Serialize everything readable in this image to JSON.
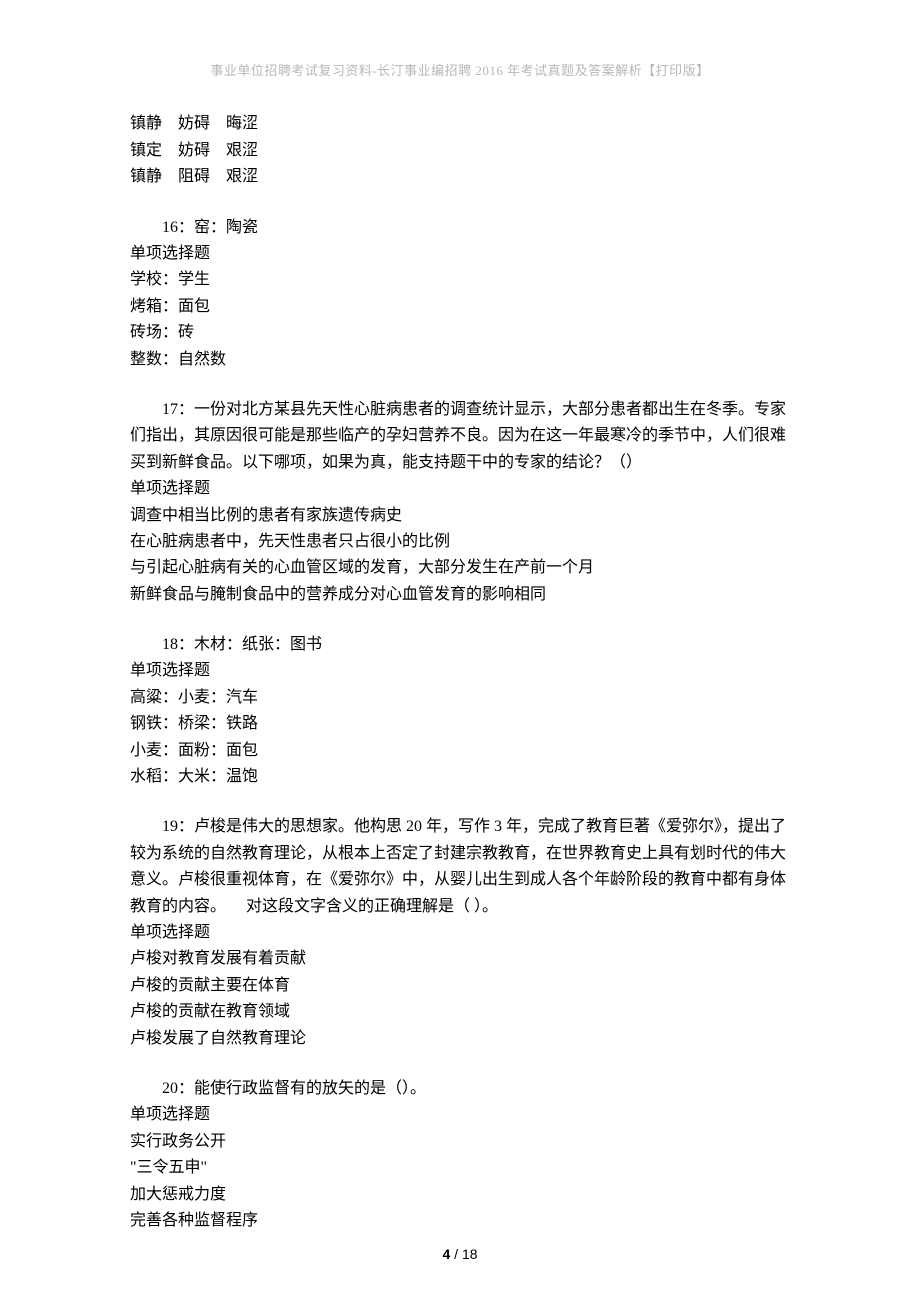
{
  "header": "事业单位招聘考试复习资料-长汀事业编招聘 2016 年考试真题及答案解析【打印版】",
  "q15_tail": {
    "lines": [
      "镇静　妨碍　晦涩",
      "镇定　妨碍　艰涩",
      "镇静　阻碍　艰涩"
    ]
  },
  "q16": {
    "title": "16：窑：陶瓷",
    "type": "单项选择题",
    "opts": [
      "学校：学生",
      "烤箱：面包",
      "砖场：砖",
      "整数：自然数"
    ]
  },
  "q17": {
    "title": "17：一份对北方某县先天性心脏病患者的调查统计显示，大部分患者都出生在冬季。专家们指出，其原因很可能是那些临产的孕妇营养不良。因为在这一年最寒冷的季节中，人们很难买到新鲜食品。以下哪项，如果为真，能支持题干中的专家的结论？（）",
    "type": "单项选择题",
    "opts": [
      "调查中相当比例的患者有家族遗传病史",
      "在心脏病患者中，先天性患者只占很小的比例",
      "与引起心脏病有关的心血管区域的发育，大部分发生在产前一个月",
      "新鲜食品与腌制食品中的营养成分对心血管发育的影响相同"
    ]
  },
  "q18": {
    "title": "18：木材：纸张：图书",
    "type": "单项选择题",
    "opts": [
      "高粱：小麦：汽车",
      "钢铁：桥梁：铁路",
      "小麦：面粉：面包",
      "水稻：大米：温饱"
    ]
  },
  "q19": {
    "title": "19：卢梭是伟大的思想家。他构思 20 年，写作 3 年，完成了教育巨著《爱弥尔》，提出了较为系统的自然教育理论，从根本上否定了封建宗教教育，在世界教育史上具有划时代的伟大意义。卢梭很重视体育，在《爱弥尔》中，从婴儿出生到成人各个年龄阶段的教育中都有身体教育的内容。 　对这段文字含义的正确理解是（  ）。",
    "type": "单项选择题",
    "opts": [
      "卢梭对教育发展有着贡献",
      "卢梭的贡献主要在体育",
      "卢梭的贡献在教育领域",
      "卢梭发展了自然教育理论"
    ]
  },
  "q20": {
    "title": "20：能使行政监督有的放矢的是（）。",
    "type": "单项选择题",
    "opts": [
      "实行政务公开",
      "\"三令五申\"",
      "加大惩戒力度",
      "完善各种监督程序"
    ]
  },
  "page": {
    "current": "4",
    "sep": " / ",
    "total": "18"
  }
}
